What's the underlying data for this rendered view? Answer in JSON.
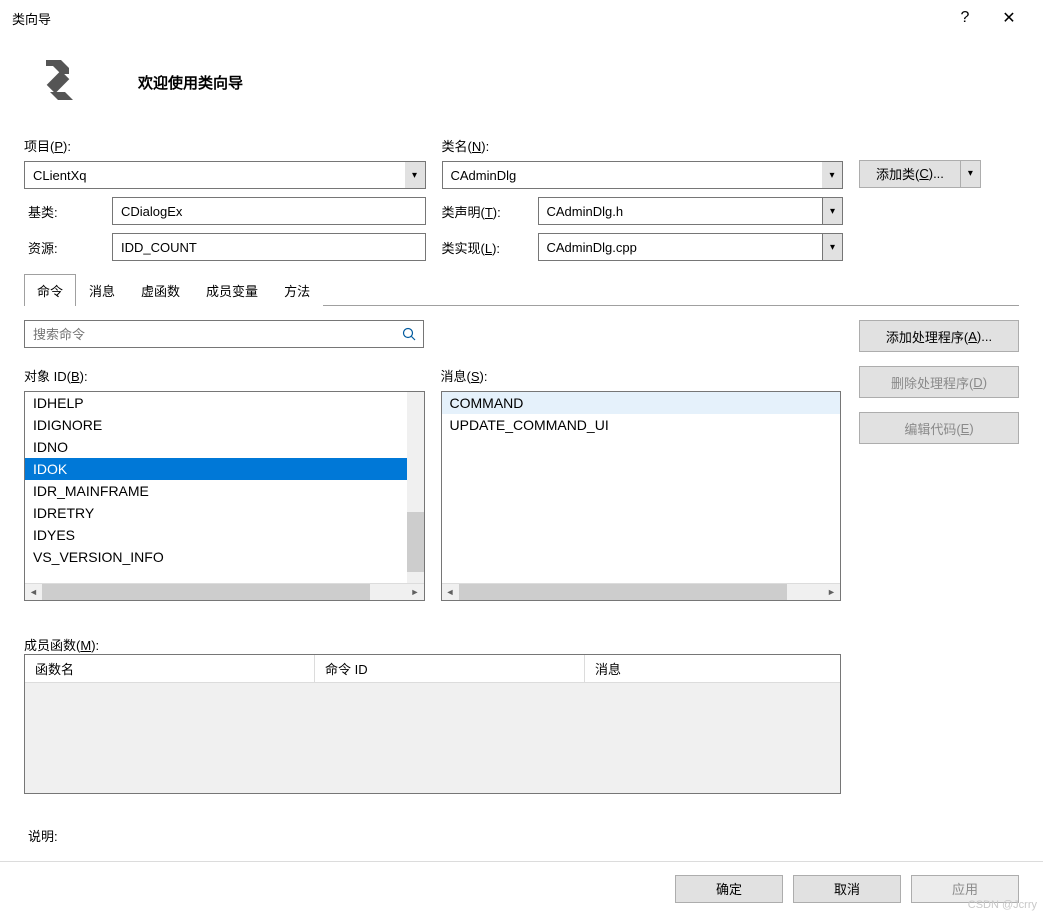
{
  "titlebar": {
    "title": "类向导"
  },
  "header": {
    "title": "欢迎使用类向导"
  },
  "labels": {
    "project": "项目(P):",
    "class_name": "类名(N):",
    "base_class": "基类:",
    "class_decl": "类声明(T):",
    "resource": "资源:",
    "class_impl": "类实现(L):",
    "add_class": "添加类(C)...",
    "object_id": "对象 ID(B):",
    "messages": "消息(S):",
    "member_funcs": "成员函数(M):",
    "description": "说明:"
  },
  "fields": {
    "project": "CLientXq",
    "class_name": "CAdminDlg",
    "base_class": "CDialogEx",
    "class_decl": "CAdminDlg.h",
    "resource": "IDD_COUNT",
    "class_impl": "CAdminDlg.cpp"
  },
  "tabs": [
    "命令",
    "消息",
    "虚函数",
    "成员变量",
    "方法"
  ],
  "search_placeholder": "搜索命令",
  "side_buttons": {
    "add_handler": "添加处理程序(A)...",
    "delete_handler": "删除处理程序(D)",
    "edit_code": "编辑代码(E)"
  },
  "object_ids": [
    "IDHELP",
    "IDIGNORE",
    "IDNO",
    "IDOK",
    "IDR_MAINFRAME",
    "IDRETRY",
    "IDYES",
    "VS_VERSION_INFO"
  ],
  "object_id_selected": "IDOK",
  "messages_list": [
    "COMMAND",
    "UPDATE_COMMAND_UI"
  ],
  "message_hl": "COMMAND",
  "member_headers": {
    "name": "函数名",
    "cmd_id": "命令 ID",
    "msg": "消息"
  },
  "footer": {
    "ok": "确定",
    "cancel": "取消",
    "apply": "应用"
  },
  "watermark": "CSDN @Jcrry"
}
